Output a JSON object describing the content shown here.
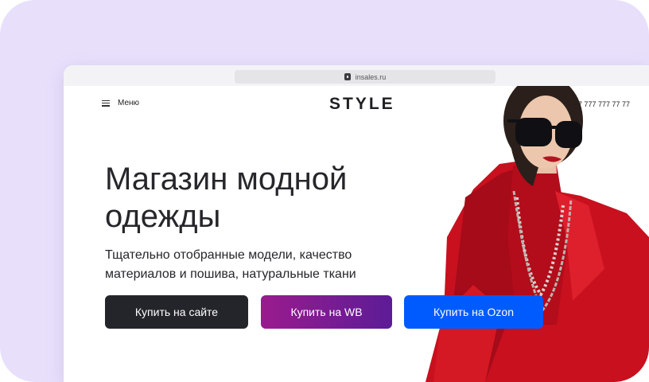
{
  "browser": {
    "url": "insales.ru"
  },
  "header": {
    "menu_label": "Меню",
    "logo": "STYLE",
    "phone": "+7 777 777 77 77"
  },
  "hero": {
    "title": "Магазин модной одежды",
    "subtitle": "Тщательно отобранные модели, качество материалов и пошива, натуральные ткани",
    "buttons": {
      "site": "Купить на сайте",
      "wb": "Купить на WB",
      "ozon": "Купить на Ozon"
    },
    "image": "model-in-red-coat-with-sunglasses"
  },
  "colors": {
    "background": "#e8e0fb",
    "button_site": "#24252b",
    "button_wb_start": "#9a1b8d",
    "button_wb_end": "#5c1c96",
    "button_ozon": "#005bff",
    "coat_red": "#c8101e"
  }
}
